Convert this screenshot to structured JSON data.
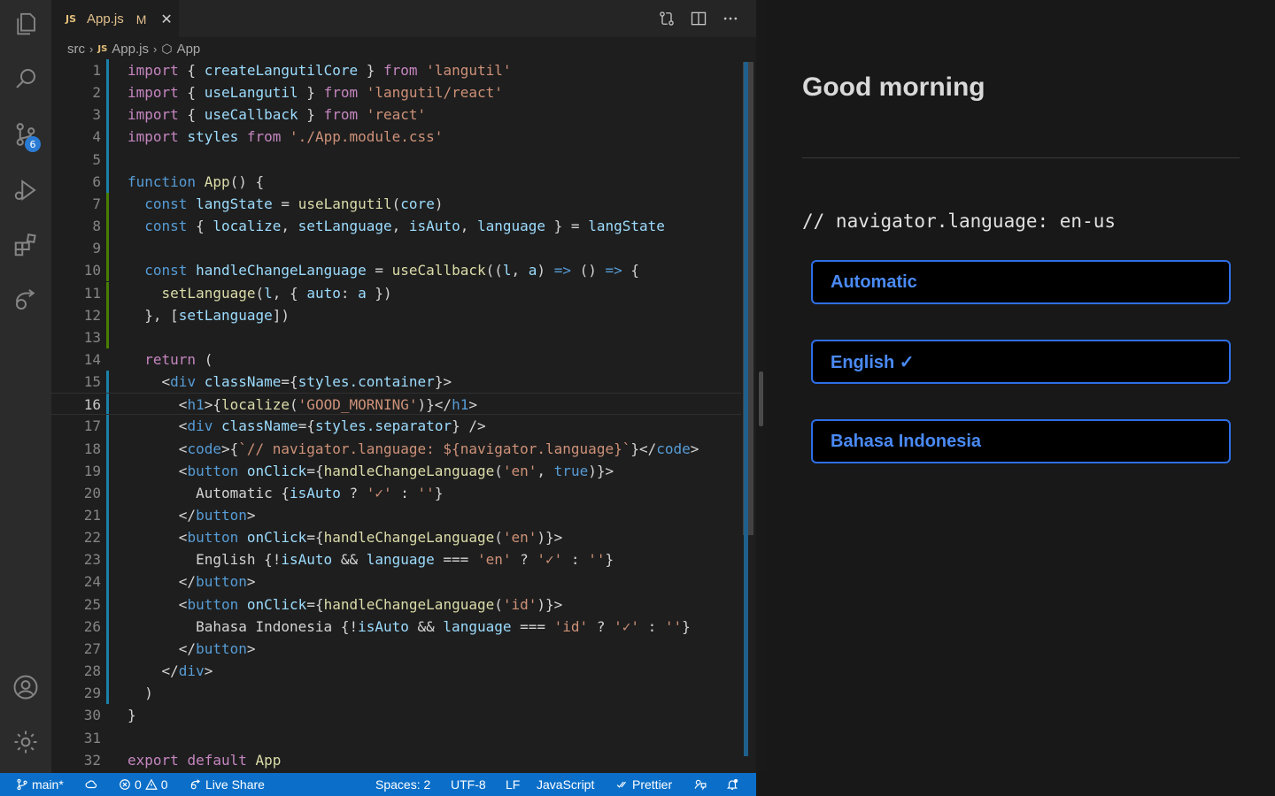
{
  "tab": {
    "badge": "JS",
    "filename": "App.js",
    "modified": "M",
    "close": "✕"
  },
  "breadcrumb": {
    "folder": "src",
    "file_badge": "JS",
    "file": "App.js",
    "symbol": "App"
  },
  "activity": {
    "scm_badge": "6"
  },
  "code": {
    "current_line": 16,
    "lines": [
      "import { createLangutilCore } from 'langutil'",
      "import { useLangutil } from 'langutil/react'",
      "import { useCallback } from 'react'",
      "import styles from './App.module.css'",
      "",
      "function App() {",
      "  const langState = useLangutil(core)",
      "  const { localize, setLanguage, isAuto, language } = langState",
      "",
      "  const handleChangeLanguage = useCallback((l, a) => () => {",
      "    setLanguage(l, { auto: a })",
      "  }, [setLanguage])",
      "",
      "  return (",
      "    <div className={styles.container}>",
      "      <h1>{localize('GOOD_MORNING')}</h1>",
      "      <div className={styles.separator} />",
      "      <code>{`// navigator.language: ${navigator.language}`}</code>",
      "      <button onClick={handleChangeLanguage('en', true)}>",
      "        Automatic {isAuto ? '✓' : ''}",
      "      </button>",
      "      <button onClick={handleChangeLanguage('en')}>",
      "        English {!isAuto && language === 'en' ? '✓' : ''}",
      "      </button>",
      "      <button onClick={handleChangeLanguage('id')}>",
      "        Bahasa Indonesia {!isAuto && language === 'id' ? '✓' : ''}",
      "      </button>",
      "    </div>",
      "  )",
      "}",
      "",
      "export default App"
    ]
  },
  "preview": {
    "title": "Good morning",
    "code_text": "// navigator.language: en-us",
    "buttons": [
      "Automatic",
      "English ✓",
      "Bahasa Indonesia"
    ]
  },
  "status": {
    "branch": "main*",
    "errors": "0",
    "warnings": "0",
    "live_share": "Live Share",
    "spaces": "Spaces: 2",
    "encoding": "UTF-8",
    "eol": "LF",
    "language": "JavaScript",
    "formatter": "Prettier"
  },
  "colors": {
    "accent": "#0b6fc9",
    "button_border": "#2f6fe6",
    "button_text": "#4a8af5"
  }
}
